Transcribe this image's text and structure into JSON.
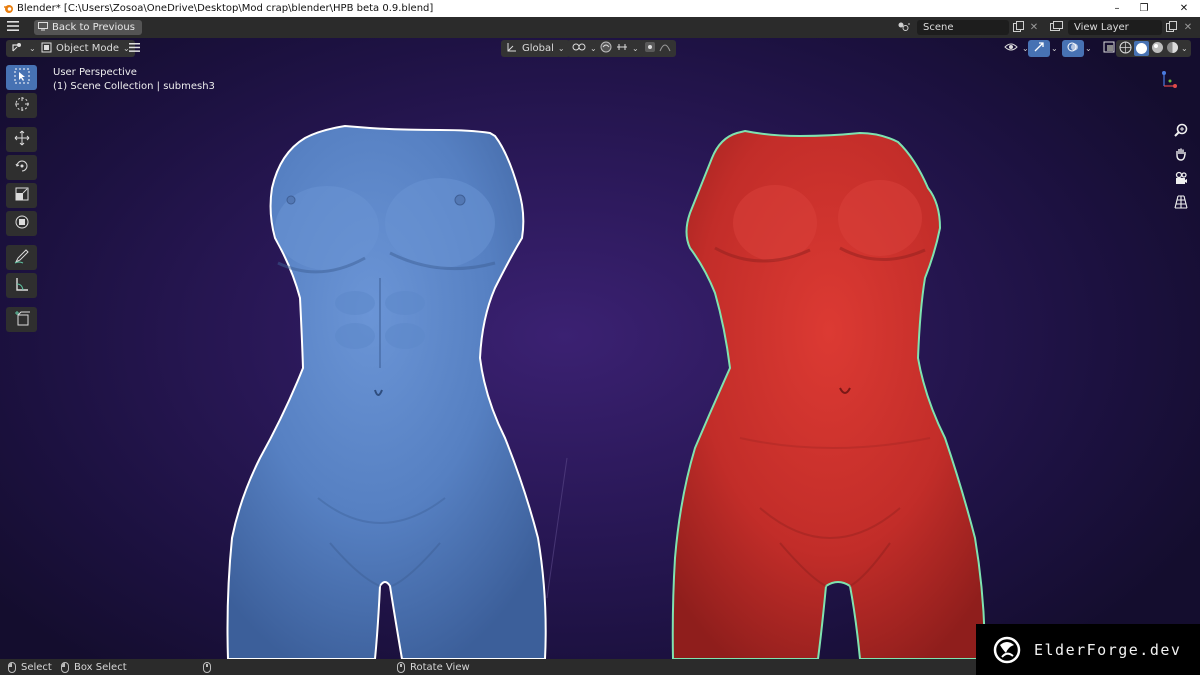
{
  "window": {
    "title": "Blender* [C:\\Users\\Zosoa\\OneDrive\\Desktop\\Mod crap\\blender\\HPB beta 0.9.blend]",
    "minimize_glyph": "–",
    "maximize_glyph": "❐",
    "close_glyph": "✕"
  },
  "topbar": {
    "menu_icon": "hamburger-icon",
    "back_label": "Back to Previous",
    "scene_field": "Scene",
    "view_layer_field": "View Layer"
  },
  "viewport_header": {
    "mode_label": "Object Mode",
    "orientation_label": "Global"
  },
  "overlay_text": {
    "perspective": "User Perspective",
    "collection": "(1) Scene Collection | submesh3"
  },
  "toolbar": {
    "tools": [
      "select-box-icon",
      "cursor-icon",
      "move-icon",
      "rotate-icon",
      "scale-icon",
      "transform-icon",
      "annotate-icon",
      "measure-icon",
      "add-cube-icon"
    ],
    "active_index": 0
  },
  "navigation": {
    "icons": [
      "zoom-icon",
      "hand-pan-icon",
      "camera-icon",
      "grid-perspective-icon"
    ],
    "axes": [
      "Z",
      "X",
      "Y"
    ]
  },
  "statusbar": {
    "select": "Select",
    "box_select": "Box Select",
    "rotate_view": "Rotate View"
  },
  "watermark": {
    "text": "ElderForge.dev"
  },
  "colors": {
    "accent": "#4772b3",
    "blue_mesh": "#5a82c4",
    "red_mesh": "#c9302c",
    "outline_selected": "#ffffff",
    "outline_active": "#7fe3b0"
  }
}
